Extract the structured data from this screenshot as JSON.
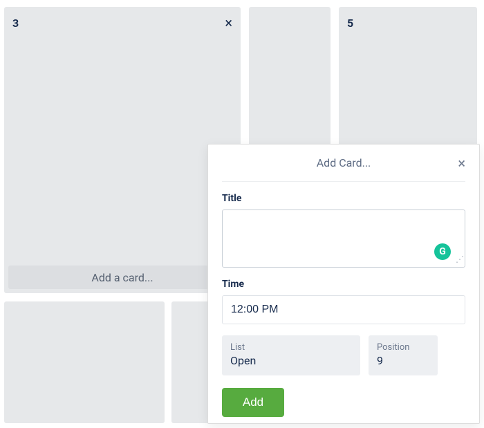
{
  "board": {
    "lists": [
      {
        "number": "3",
        "has_close": true,
        "add_card_label": "Add a card..."
      },
      {
        "number": ""
      },
      {
        "number": "5"
      },
      {
        "number": ""
      },
      {
        "number": ""
      }
    ]
  },
  "dialog": {
    "title": "Add Card...",
    "fields": {
      "title_label": "Title",
      "title_value": "",
      "time_label": "Time",
      "time_value": "12:00 PM"
    },
    "meta": {
      "list_label": "List",
      "list_value": "Open",
      "position_label": "Position",
      "position_value": "9"
    },
    "submit_label": "Add"
  },
  "icons": {
    "grammarly_letter": "G"
  }
}
